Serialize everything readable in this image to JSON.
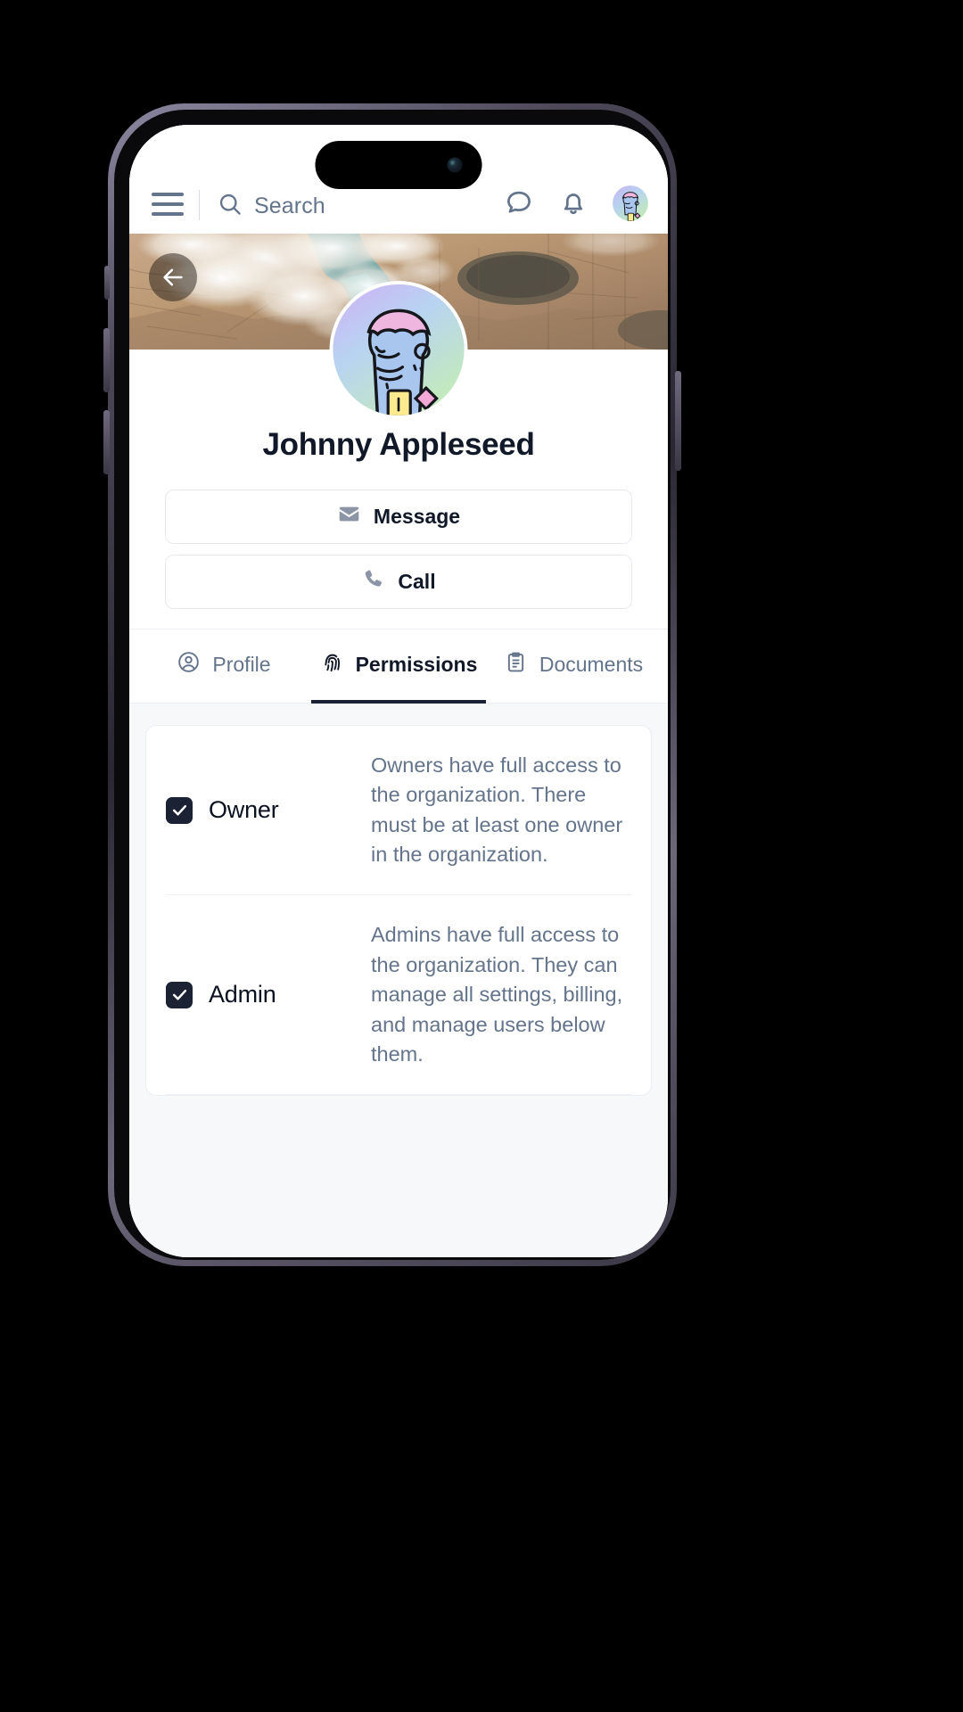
{
  "navbar": {
    "menu_icon": "hamburger-menu-icon",
    "search_icon": "search-icon",
    "search_placeholder": "Search",
    "chat_icon": "chat-bubble-icon",
    "bell_icon": "bell-icon",
    "avatar_icon": "user-avatar"
  },
  "cover": {
    "back_icon": "arrow-left-icon",
    "image_alt": "aerial-satellite-landscape"
  },
  "profile": {
    "name": "Johnny Appleseed",
    "avatar_alt": "user-avatar-illustration"
  },
  "actions": [
    {
      "label": "Message",
      "icon": "envelope-icon"
    },
    {
      "label": "Call",
      "icon": "phone-icon"
    }
  ],
  "tabs": [
    {
      "label": "Profile",
      "icon": "user-circle-icon",
      "active": false
    },
    {
      "label": "Permissions",
      "icon": "fingerprint-icon",
      "active": true
    },
    {
      "label": "Documents",
      "icon": "clipboard-icon",
      "active": false
    }
  ],
  "permissions": [
    {
      "label": "Owner",
      "checked": true,
      "description": "Owners have full access to the organization. There must be at least one owner in the organization."
    },
    {
      "label": "Admin",
      "checked": true,
      "description": "Admins have full access to the organization. They can manage all settings, billing, and manage users below them."
    }
  ],
  "colors": {
    "accent_dark": "#1a2234",
    "text_primary": "#0b1120",
    "text_muted": "#64748b",
    "surface": "#f6f8fa",
    "border": "#eaeef3"
  }
}
